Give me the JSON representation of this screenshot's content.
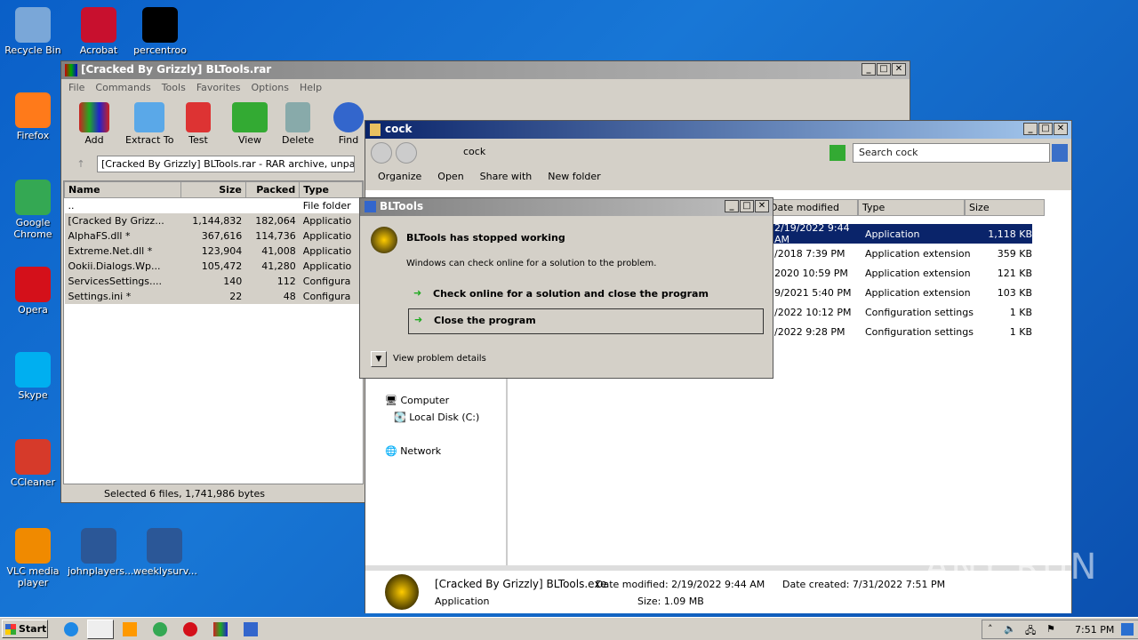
{
  "desktop": {
    "icons": [
      {
        "label": "Recycle Bin",
        "color": "#7aa7d8"
      },
      {
        "label": "Acrobat",
        "color": "#c8102e"
      },
      {
        "label": "percentroo",
        "color": "#000000"
      },
      {
        "label": "Firefox",
        "color": "#ff7a1a"
      },
      {
        "label": "Google Chrome",
        "color": "#34a853"
      },
      {
        "label": "Opera",
        "color": "#d4101a"
      },
      {
        "label": "Skype",
        "color": "#00aff0"
      },
      {
        "label": "CCleaner",
        "color": "#d63a2a"
      },
      {
        "label": "VLC media player",
        "color": "#f08a00"
      },
      {
        "label": "johnplayers...",
        "color": "#2b5797"
      },
      {
        "label": "weeklysurv...",
        "color": "#2b5797"
      }
    ]
  },
  "winrar": {
    "title": "[Cracked By Grizzly] BLTools.rar",
    "menu": [
      "File",
      "Commands",
      "Tools",
      "Favorites",
      "Options",
      "Help"
    ],
    "tools": [
      "Add",
      "Extract To",
      "Test",
      "View",
      "Delete",
      "Find"
    ],
    "path": "[Cracked By Grizzly] BLTools.rar - RAR archive, unpack",
    "columns": [
      "Name",
      "Size",
      "Packed",
      "Type"
    ],
    "rows": [
      [
        "..",
        "",
        "",
        "File folder"
      ],
      [
        "[Cracked By Grizz...",
        "1,144,832",
        "182,064",
        "Applicatio"
      ],
      [
        "AlphaFS.dll *",
        "367,616",
        "114,736",
        "Applicatio"
      ],
      [
        "Extreme.Net.dll *",
        "123,904",
        "41,008",
        "Applicatio"
      ],
      [
        "Ookii.Dialogs.Wp...",
        "105,472",
        "41,280",
        "Applicatio"
      ],
      [
        "ServicesSettings....",
        "140",
        "112",
        "Configura"
      ],
      [
        "Settings.ini *",
        "22",
        "48",
        "Configura"
      ]
    ],
    "status": "Selected 6 files, 1,741,986 bytes"
  },
  "explorer": {
    "title": "cock",
    "address": "cock",
    "search_placeholder": "Search cock",
    "toolbar": [
      "Organize",
      "Open",
      "Share with",
      "New folder"
    ],
    "columns": [
      "Date modified",
      "Type",
      "Size"
    ],
    "rows": [
      [
        "2/19/2022 9:44 AM",
        "Application",
        "1,118 KB"
      ],
      [
        "/2018 7:39 PM",
        "Application extension",
        "359 KB"
      ],
      [
        "2020 10:59 PM",
        "Application extension",
        "121 KB"
      ],
      [
        "9/2021 5:40 PM",
        "Application extension",
        "103 KB"
      ],
      [
        "/2022 10:12 PM",
        "Configuration settings",
        "1 KB"
      ],
      [
        "/2022 9:28 PM",
        "Configuration settings",
        "1 KB"
      ]
    ],
    "nav": [
      "Computer",
      "Local Disk (C:)",
      "Network"
    ],
    "details": {
      "name": "[Cracked By Grizzly] BLTools.exe",
      "type": "Application",
      "modified": "Date modified: 2/19/2022 9:44 AM",
      "size": "Size: 1.09 MB",
      "created": "Date created: 7/31/2022 7:51 PM"
    }
  },
  "dialog": {
    "title": "BLTools",
    "heading": "BLTools has stopped working",
    "message": "Windows can check online for a solution to the problem.",
    "option1": "Check online for a solution and close the program",
    "option2": "Close the program",
    "details": "View problem details"
  },
  "taskbar": {
    "start": "Start",
    "clock": "7:51 PM"
  },
  "watermark": "ANY RUN"
}
